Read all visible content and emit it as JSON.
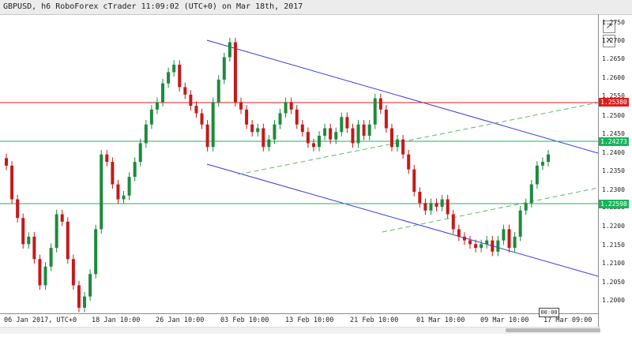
{
  "title": "GBPUSD, h6 RoboForex cTrader 11:09:02 (UTC+0) on Mar 18th, 2017",
  "price_axis": {
    "labels": [
      "1.2750",
      "1.2700",
      "1.2650",
      "1.2600",
      "1.2550",
      "1.2500",
      "1.2450",
      "1.2400",
      "1.2350",
      "1.2300",
      "1.2250",
      "1.2200",
      "1.2150",
      "1.2100",
      "1.2050",
      "1.2000"
    ]
  },
  "date_axis": {
    "labels": [
      "06 Jan 2017, UTC+0",
      "18 Jan 10:00",
      "26 Jan 10:00",
      "03 Feb 10:00",
      "13 Feb 10:00",
      "21 Feb 10:00",
      "01 Mar 10:00",
      "09 Mar 10:00",
      "17 Mar 09:00"
    ]
  },
  "horizontal_lines": [
    {
      "value": "1.25380",
      "color": "#e01e1e"
    },
    {
      "value": "1.24273",
      "color": "#18b45a"
    },
    {
      "value": "1.22598",
      "color": "#18b45a"
    }
  ],
  "time_badge": "00:00",
  "colors": {
    "bull": "#1e8a3c",
    "bear": "#c41a1a",
    "channel": "#3a3adf",
    "dashed": "#5fb56b"
  },
  "icons": [
    "popout-icon",
    "close-icon"
  ],
  "chart_data": {
    "type": "candlestick",
    "symbol": "GBPUSD",
    "timeframe": "h6",
    "ylim": [
      1.1975,
      1.2775
    ],
    "x_range": [
      "06 Jan 2017",
      "18 Mar 2017"
    ],
    "horizontal_levels": [
      1.2538,
      1.24273,
      1.22598
    ],
    "ohlc_close_path": [
      1.237,
      1.228,
      1.223,
      1.216,
      1.218,
      1.212,
      1.205,
      1.21,
      1.215,
      1.224,
      1.222,
      1.212,
      1.205,
      1.199,
      1.202,
      1.208,
      1.22,
      1.24,
      1.238,
      1.232,
      1.228,
      1.229,
      1.234,
      1.238,
      1.243,
      1.248,
      1.252,
      1.254,
      1.259,
      1.262,
      1.264,
      1.258,
      1.256,
      1.253,
      1.251,
      1.248,
      1.242,
      1.254,
      1.26,
      1.266,
      1.27,
      1.254,
      1.252,
      1.248,
      1.246,
      1.247,
      1.242,
      1.244,
      1.248,
      1.251,
      1.254,
      1.252,
      1.248,
      1.246,
      1.243,
      1.242,
      1.245,
      1.247,
      1.244,
      1.246,
      1.25,
      1.247,
      1.243,
      1.248,
      1.245,
      1.248,
      1.255,
      1.252,
      1.247,
      1.242,
      1.244,
      1.24,
      1.236,
      1.23,
      1.227,
      1.225,
      1.227,
      1.226,
      1.228,
      1.224,
      1.22,
      1.218,
      1.217,
      1.216,
      1.215,
      1.216,
      1.217,
      1.214,
      1.217,
      1.22,
      1.215,
      1.218,
      1.225,
      1.227,
      1.232,
      1.237,
      1.238,
      1.24
    ]
  }
}
